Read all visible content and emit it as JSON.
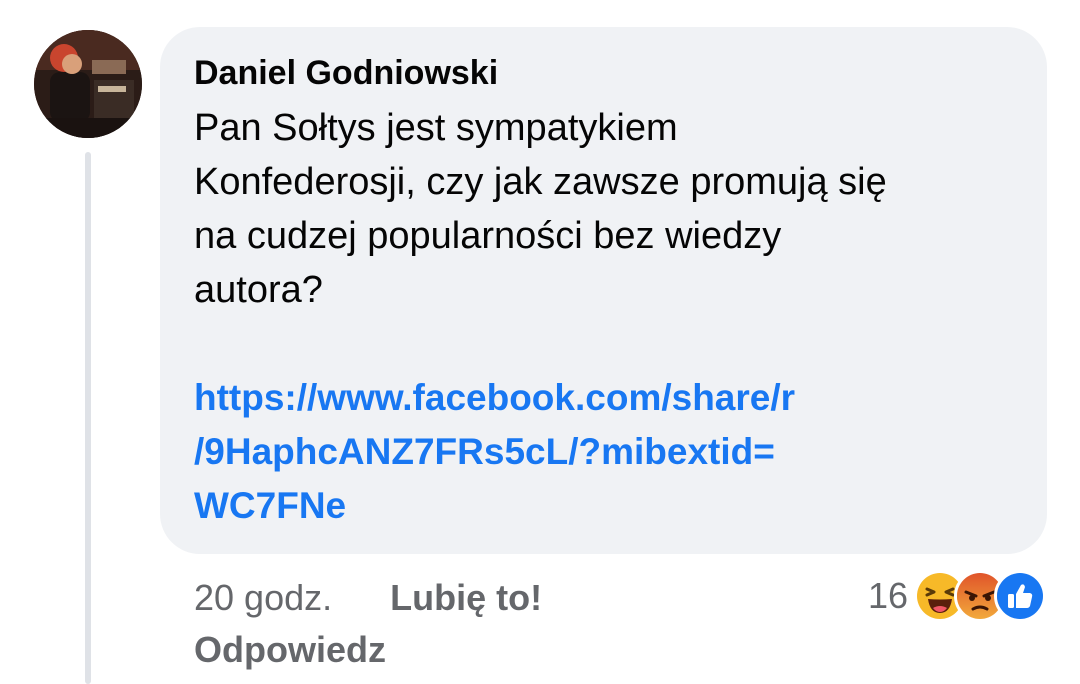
{
  "comment": {
    "author_name": "Daniel Godniowski",
    "text": "Pan Sołtys jest sympatykiem\nKonfederosji, czy jak zawsze promują się\nna cudzej popularności bez wiedzy\nautora?",
    "link": "https://www.facebook.com/share/r/9HaphcANZ7FRs5cL/?mibextid=WC7FNe",
    "link_display": "https://www.facebook.com/share/r\n/9HaphcANZ7FRs5cL/?mibextid=\nWC7FNe"
  },
  "meta": {
    "time": "20 godz.",
    "like_label": "Lubię to!",
    "reply_label": "Odpowiedz"
  },
  "reactions": {
    "count": "16",
    "icons": [
      "haha-icon",
      "angry-icon",
      "like-icon"
    ],
    "colors": {
      "haha": "#f7b928",
      "angry": "#e9710f",
      "like": "#1877f2"
    }
  }
}
